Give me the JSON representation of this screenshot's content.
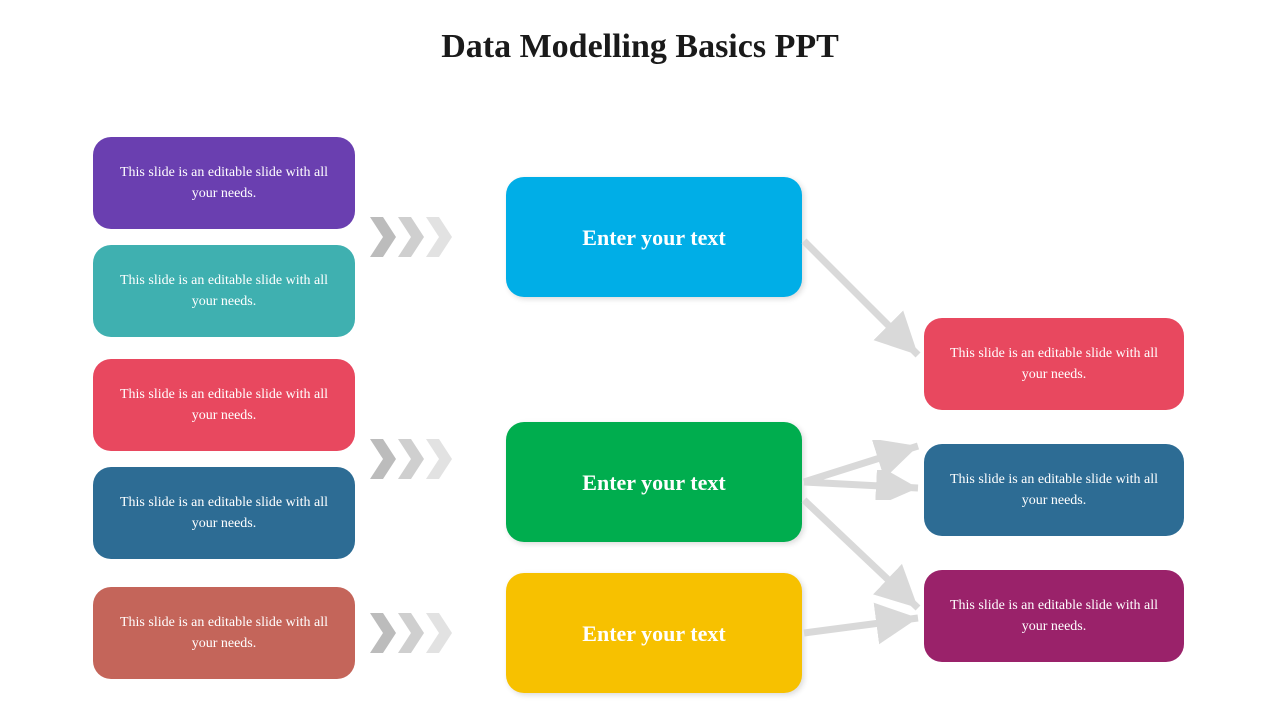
{
  "title": "Data Modelling Basics PPT",
  "left": [
    {
      "text": "This slide is an editable slide with all your needs.",
      "color": "#6a3fb0"
    },
    {
      "text": "This slide is an editable slide with all your needs.",
      "color": "#3fb0b0"
    },
    {
      "text": "This slide is an editable slide with all your needs.",
      "color": "#e8485f"
    },
    {
      "text": "This slide is an editable slide with all your needs.",
      "color": "#2d6c94"
    },
    {
      "text": "This slide is an editable slide with all your needs.",
      "color": "#c4655a"
    }
  ],
  "middle": [
    {
      "text": "Enter your text",
      "color": "#00aee7"
    },
    {
      "text": "Enter your text",
      "color": "#00ad4e"
    },
    {
      "text": "Enter your text",
      "color": "#f7c100"
    }
  ],
  "right": [
    {
      "text": "This slide is an editable slide with all your needs.",
      "color": "#e8485f"
    },
    {
      "text": "This slide is an editable slide with all your needs.",
      "color": "#2d6c94"
    },
    {
      "text": "This slide is an editable slide with all your needs.",
      "color": "#9a226a"
    }
  ]
}
